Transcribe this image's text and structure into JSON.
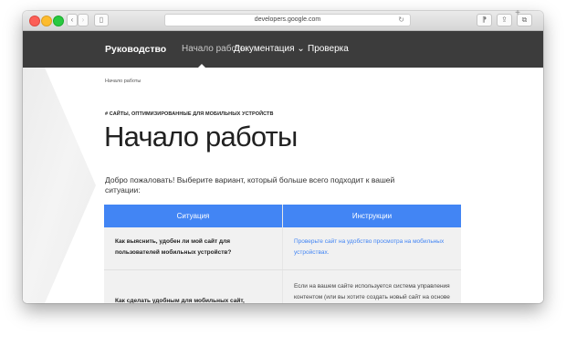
{
  "browser": {
    "url": "developers.google.com",
    "reload_icon": "↻",
    "back_icon": "‹",
    "forward_icon": "›",
    "sidebar_icon": "▯",
    "toolbar_icons": [
      "⁋",
      "⇪",
      "⧉"
    ],
    "new_tab_icon": "+"
  },
  "nav": {
    "brand": "Руководство",
    "items": [
      "Начало работы",
      "Документация ⌄",
      "Проверка"
    ]
  },
  "page": {
    "breadcrumb": "Начало работы",
    "eyebrow": "# САЙТЫ, ОПТИМИЗИРОВАННЫЕ ДЛЯ МОБИЛЬНЫХ УСТРОЙСТВ",
    "title": "Начало работы",
    "intro": "Добро пожаловать! Выберите вариант, который больше всего подходит к вашей ситуации:"
  },
  "table": {
    "headers": [
      "Ситуация",
      "Инструкции"
    ],
    "rows": [
      {
        "question": "Как выяснить, удобен ли мой сайт для пользователей мобильных устройств?",
        "answer": "Проверьте сайт на удобство просмотра на мобильных устройствах."
      },
      {
        "question": "Как сделать удобным для мобильных сайт, созданный на основе CMS?",
        "answer": "Если на вашем сайте используется система управления контентом (или вы хотите создать новый сайт на основе CMS), воспользуйтесь"
      }
    ]
  },
  "colors": {
    "navbar": "#3c3c3c",
    "table_header": "#4285f4",
    "link": "#4285f4",
    "row_bg": "#f1f1f1"
  }
}
